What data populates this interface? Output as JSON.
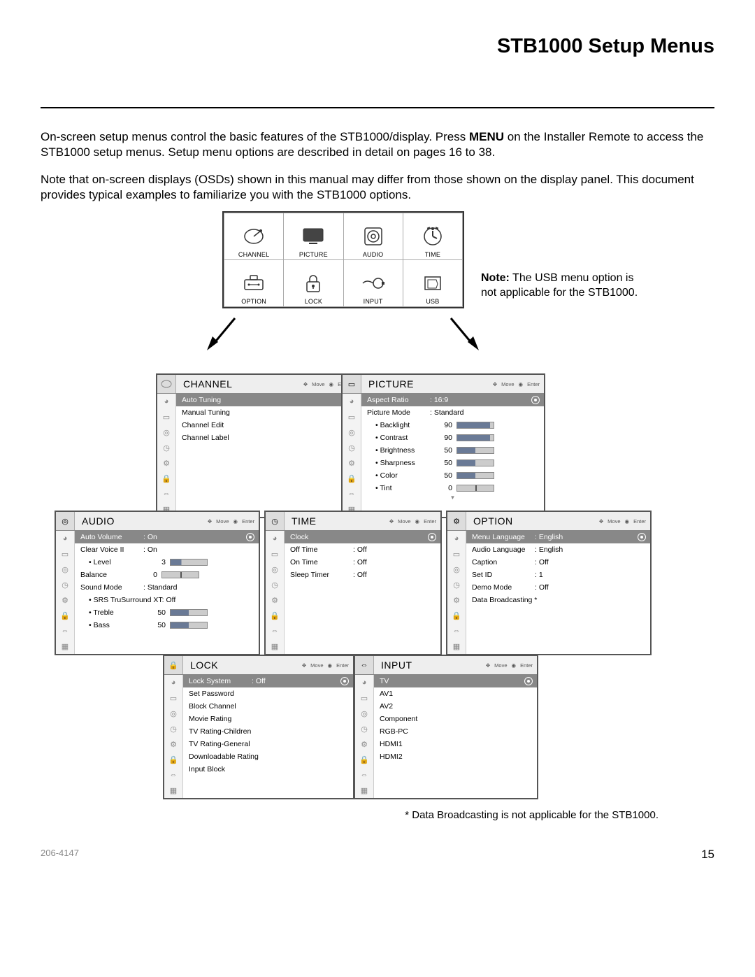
{
  "title": "STB1000 Setup Menus",
  "para1_a": "On-screen setup menus control the basic features of the STB1000/display. Press ",
  "para1_b": "MENU",
  "para1_c": " on the Installer Remote to access the STB1000 setup menus. Setup menu options are described in detail on pages 16 to 38.",
  "para2": "Note that on-screen displays (OSDs) shown in this manual may differ from those shown on the display panel. This document provides typical examples to familiarize you with the STB1000 options.",
  "side_note_a": "Note:",
  "side_note_b": " The USB menu option is not applicable for the STB1000.",
  "grid": {
    "cells": [
      {
        "label": "CHANNEL",
        "icon": "satellite"
      },
      {
        "label": "PICTURE",
        "icon": "tv"
      },
      {
        "label": "AUDIO",
        "icon": "speaker"
      },
      {
        "label": "TIME",
        "icon": "clock"
      },
      {
        "label": "OPTION",
        "icon": "toolbox"
      },
      {
        "label": "LOCK",
        "icon": "lock"
      },
      {
        "label": "INPUT",
        "icon": "plug"
      },
      {
        "label": "USB",
        "icon": "usb"
      }
    ]
  },
  "hints": {
    "move": "Move",
    "enter": "Enter"
  },
  "channel": {
    "title": "CHANNEL",
    "selected": "Auto Tuning",
    "items": [
      "Manual Tuning",
      "Channel Edit",
      "Channel Label"
    ]
  },
  "picture": {
    "title": "PICTURE",
    "selected": {
      "label": "Aspect Ratio",
      "value": ": 16:9"
    },
    "mode": {
      "label": "Picture Mode",
      "value": ": Standard"
    },
    "sliders": [
      {
        "label": "• Backlight",
        "num": "90",
        "fill": 90
      },
      {
        "label": "• Contrast",
        "num": "90",
        "fill": 90
      },
      {
        "label": "• Brightness",
        "num": "50",
        "fill": 50
      },
      {
        "label": "• Sharpness",
        "num": "50",
        "fill": 50
      },
      {
        "label": "• Color",
        "num": "50",
        "fill": 50
      }
    ],
    "tint": {
      "label": "• Tint",
      "num": "0"
    }
  },
  "audio": {
    "title": "AUDIO",
    "selected": {
      "label": "Auto Volume",
      "value": ": On"
    },
    "items": [
      {
        "label": "Clear Voice II",
        "value": ": On"
      },
      {
        "label": "• Level",
        "num": "3",
        "fill": 30,
        "sub": true
      },
      {
        "label": "Balance",
        "num": "0",
        "center": true
      },
      {
        "label": "Sound Mode",
        "value": ": Standard"
      },
      {
        "label": "• SRS TruSurround XT: Off",
        "sub": true
      },
      {
        "label": "• Treble",
        "num": "50",
        "fill": 50,
        "sub": true
      },
      {
        "label": "• Bass",
        "num": "50",
        "fill": 50,
        "sub": true
      }
    ]
  },
  "time": {
    "title": "TIME",
    "selected": "Clock",
    "items": [
      {
        "label": "Off Time",
        "value": ": Off"
      },
      {
        "label": "On Time",
        "value": ": Off"
      },
      {
        "label": "Sleep Timer",
        "value": ": Off"
      }
    ]
  },
  "option": {
    "title": "OPTION",
    "selected": {
      "label": "Menu Language",
      "value": ": English"
    },
    "items": [
      {
        "label": "Audio Language",
        "value": ": English"
      },
      {
        "label": "Caption",
        "value": ": Off"
      },
      {
        "label": "Set ID",
        "value": ": 1"
      },
      {
        "label": "Demo Mode",
        "value": ": Off"
      },
      {
        "label": "Data Broadcasting *"
      }
    ]
  },
  "lock": {
    "title": "LOCK",
    "selected": {
      "label": "Lock System",
      "value": ": Off"
    },
    "items": [
      "Set Password",
      "Block Channel",
      "Movie Rating",
      "TV Rating-Children",
      "TV Rating-General",
      "Downloadable Rating",
      "Input Block"
    ]
  },
  "input": {
    "title": "INPUT",
    "selected": "TV",
    "items": [
      "AV1",
      "AV2",
      "Component",
      "RGB-PC",
      "HDMI1",
      "HDMI2"
    ]
  },
  "footnote": "* Data Broadcasting is not applicable for the STB1000.",
  "footer_left": "206-4147",
  "footer_right": "15"
}
